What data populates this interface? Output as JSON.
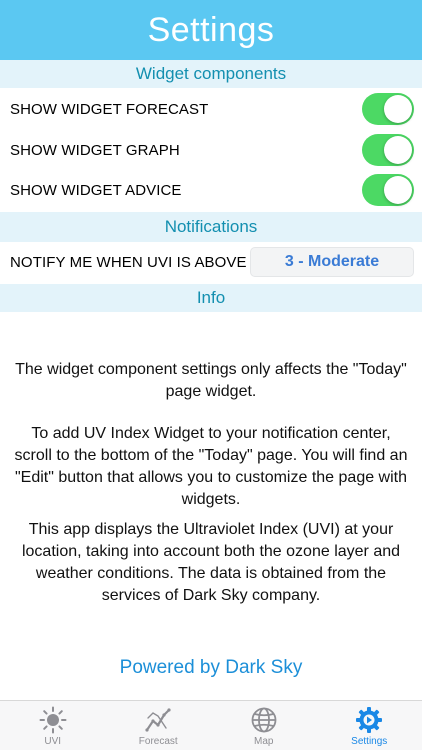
{
  "header": {
    "title": "Settings"
  },
  "widget_section": {
    "title": "Widget components",
    "items": [
      {
        "label": "SHOW WIDGET FORECAST",
        "enabled": true
      },
      {
        "label": "SHOW WIDGET GRAPH",
        "enabled": true
      },
      {
        "label": "SHOW WIDGET ADVICE",
        "enabled": true
      }
    ]
  },
  "notifications_section": {
    "title": "Notifications",
    "notify_label": "NOTIFY ME WHEN UVI IS ABOVE",
    "threshold_value": "3 - Moderate"
  },
  "info_section": {
    "title": "Info",
    "paragraphs": [
      "The widget component settings only affects the \"Today\" page widget.",
      "To add UV Index Widget to your notification center, scroll to the bottom of the \"Today\" page. You will find an \"Edit\" button that allows you to customize the page with widgets.",
      "This app displays the Ultraviolet Index (UVI) at your location, taking into account both the ozone layer and weather conditions. The data is obtained from the services of Dark Sky company."
    ]
  },
  "powered_by": "Powered by Dark Sky",
  "tabbar": {
    "tabs": [
      {
        "label": "UVI",
        "icon": "sun-icon",
        "active": false
      },
      {
        "label": "Forecast",
        "icon": "chart-icon",
        "active": false
      },
      {
        "label": "Map",
        "icon": "globe-icon",
        "active": false
      },
      {
        "label": "Settings",
        "icon": "gear-icon",
        "active": true
      }
    ]
  },
  "colors": {
    "header_bg": "#5bc8f2",
    "section_bg": "#e3f3fa",
    "section_text": "#138fb0",
    "toggle_on": "#4cd964",
    "accent_blue": "#1a88e6"
  }
}
